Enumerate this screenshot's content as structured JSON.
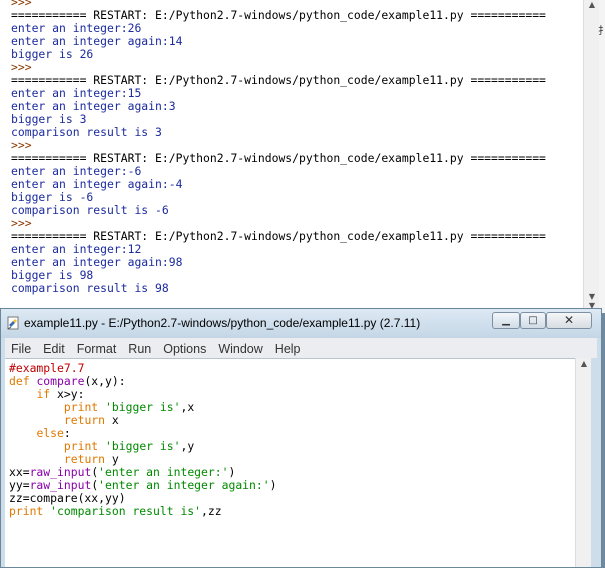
{
  "shell": {
    "lines": [
      {
        "text": ">>>",
        "color": "brown"
      },
      {
        "text": "=========== RESTART: E:/Python2.7-windows/python_code/example11.py ===========",
        "color": "black"
      },
      {
        "text": "enter an integer:26",
        "color": "blue"
      },
      {
        "text": "enter an integer again:14",
        "color": "blue"
      },
      {
        "text": "bigger is 26",
        "color": "blue"
      },
      {
        "text": ">>>",
        "color": "brown"
      },
      {
        "text": "=========== RESTART: E:/Python2.7-windows/python_code/example11.py ===========",
        "color": "black"
      },
      {
        "text": "enter an integer:15",
        "color": "blue"
      },
      {
        "text": "enter an integer again:3",
        "color": "blue"
      },
      {
        "text": "bigger is 3",
        "color": "blue"
      },
      {
        "text": "comparison result is 3",
        "color": "blue"
      },
      {
        "text": ">>>",
        "color": "brown"
      },
      {
        "text": "=========== RESTART: E:/Python2.7-windows/python_code/example11.py ===========",
        "color": "black"
      },
      {
        "text": "enter an integer:-6",
        "color": "blue"
      },
      {
        "text": "enter an integer again:-4",
        "color": "blue"
      },
      {
        "text": "bigger is -6",
        "color": "blue"
      },
      {
        "text": "comparison result is -6",
        "color": "blue"
      },
      {
        "text": ">>>",
        "color": "brown"
      },
      {
        "text": "=========== RESTART: E:/Python2.7-windows/python_code/example11.py ===========",
        "color": "black"
      },
      {
        "text": "enter an integer:12",
        "color": "blue"
      },
      {
        "text": "enter an integer again:98",
        "color": "blue"
      },
      {
        "text": "bigger is 98",
        "color": "blue"
      },
      {
        "text": "comparison result is 98",
        "color": "blue"
      }
    ],
    "side_glyph": "扌"
  },
  "editor": {
    "title": "example11.py - E:/Python2.7-windows/python_code/example11.py (2.7.11)",
    "menu": [
      "File",
      "Edit",
      "Format",
      "Run",
      "Options",
      "Window",
      "Help"
    ],
    "code_lines": [
      [
        {
          "t": "#example7.7",
          "c": "red"
        }
      ],
      [
        {
          "t": "def",
          "c": "orange"
        },
        {
          "t": " ",
          "c": "black"
        },
        {
          "t": "compare",
          "c": "purple"
        },
        {
          "t": "(x,y):",
          "c": "black"
        }
      ],
      [
        {
          "t": "    ",
          "c": "black"
        },
        {
          "t": "if",
          "c": "orange"
        },
        {
          "t": " x>y:",
          "c": "black"
        }
      ],
      [
        {
          "t": "        ",
          "c": "black"
        },
        {
          "t": "print",
          "c": "orange"
        },
        {
          "t": " ",
          "c": "black"
        },
        {
          "t": "'bigger is'",
          "c": "green"
        },
        {
          "t": ",x",
          "c": "black"
        }
      ],
      [
        {
          "t": "        ",
          "c": "black"
        },
        {
          "t": "return",
          "c": "orange"
        },
        {
          "t": " x",
          "c": "black"
        }
      ],
      [
        {
          "t": "    ",
          "c": "black"
        },
        {
          "t": "else",
          "c": "orange"
        },
        {
          "t": ":",
          "c": "black"
        }
      ],
      [
        {
          "t": "        ",
          "c": "black"
        },
        {
          "t": "print",
          "c": "orange"
        },
        {
          "t": " ",
          "c": "black"
        },
        {
          "t": "'bigger is'",
          "c": "green"
        },
        {
          "t": ",y",
          "c": "black"
        }
      ],
      [
        {
          "t": "        ",
          "c": "black"
        },
        {
          "t": "return",
          "c": "orange"
        },
        {
          "t": " y",
          "c": "black"
        }
      ],
      [
        {
          "t": "xx=",
          "c": "black"
        },
        {
          "t": "raw_input",
          "c": "purple"
        },
        {
          "t": "(",
          "c": "black"
        },
        {
          "t": "'enter an integer:'",
          "c": "green"
        },
        {
          "t": ")",
          "c": "black"
        }
      ],
      [
        {
          "t": "yy=",
          "c": "black"
        },
        {
          "t": "raw_input",
          "c": "purple"
        },
        {
          "t": "(",
          "c": "black"
        },
        {
          "t": "'enter an integer again:'",
          "c": "green"
        },
        {
          "t": ")",
          "c": "black"
        }
      ],
      [
        {
          "t": "zz=compare(xx,yy)",
          "c": "black"
        }
      ],
      [
        {
          "t": "print",
          "c": "orange"
        },
        {
          "t": " ",
          "c": "black"
        },
        {
          "t": "'comparison result is'",
          "c": "green"
        },
        {
          "t": ",zz",
          "c": "black"
        }
      ]
    ]
  },
  "icons": {
    "app": "python-idle-icon",
    "minimize": "minimize-icon",
    "maximize": "maximize-icon",
    "close": "close-icon"
  }
}
